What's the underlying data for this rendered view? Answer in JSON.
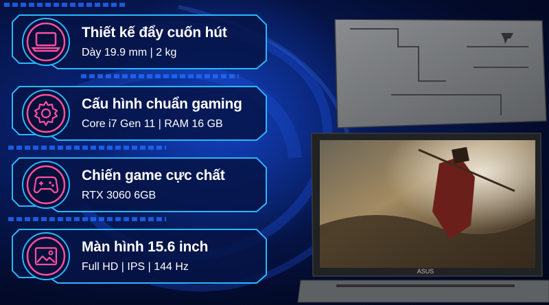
{
  "features": [
    {
      "icon": "laptop-icon",
      "title": "Thiết kế đẩy cuốn hút",
      "subtitle": "Dày 19.9 mm  |  2 kg"
    },
    {
      "icon": "gear-icon",
      "title": "Cấu hình chuẩn gaming",
      "subtitle": "Core i7 Gen 11  |  RAM 16 GB"
    },
    {
      "icon": "gamepad-icon",
      "title": "Chiến game cực chất",
      "subtitle": "RTX 3060 6GB"
    },
    {
      "icon": "image-icon",
      "title": "Màn hình 15.6 inch",
      "subtitle": "Full HD  |  IPS  |  144 Hz"
    }
  ],
  "laptop": {
    "brand_logo": "ASUS"
  },
  "colors": {
    "accent": "#29b8ff",
    "icon": "#ff4fa0",
    "panel": "#061446"
  }
}
